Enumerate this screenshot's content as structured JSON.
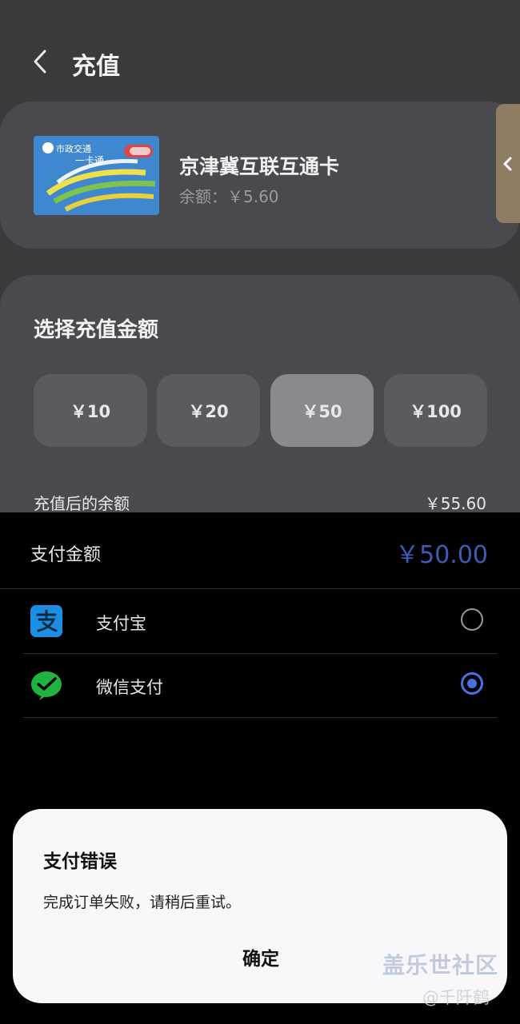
{
  "header": {
    "title": "充值",
    "back_icon": "chevron-left-icon"
  },
  "card": {
    "name": "京津冀互联互通卡",
    "balance": "余额：￥5.60",
    "image_text": {
      "brand": "市政交通",
      "product": "一卡通"
    },
    "side_tab_icon": "chevron-left-icon"
  },
  "amount": {
    "title": "选择充值金额",
    "options": [
      "￥10",
      "￥20",
      "￥50",
      "￥100"
    ],
    "selected_index": 2,
    "after_label": "充值后的余额",
    "after_value": "￥55.60"
  },
  "payment": {
    "label": "支付金额",
    "value": "￥50.00",
    "methods": [
      {
        "label": "支付宝",
        "icon": "alipay-icon",
        "selected": false
      },
      {
        "label": "微信支付",
        "icon": "wechat-pay-icon",
        "selected": true
      }
    ]
  },
  "dialog": {
    "title": "支付错误",
    "message": "完成订单失败，请稍后重试。",
    "confirm": "确定"
  },
  "watermark": {
    "line1": "盖乐世社区",
    "line2": "@千阡鹤"
  },
  "colors": {
    "accent": "#3e5bb6",
    "radio_on": "#4a6fe0",
    "tab": "#8e7d63"
  }
}
